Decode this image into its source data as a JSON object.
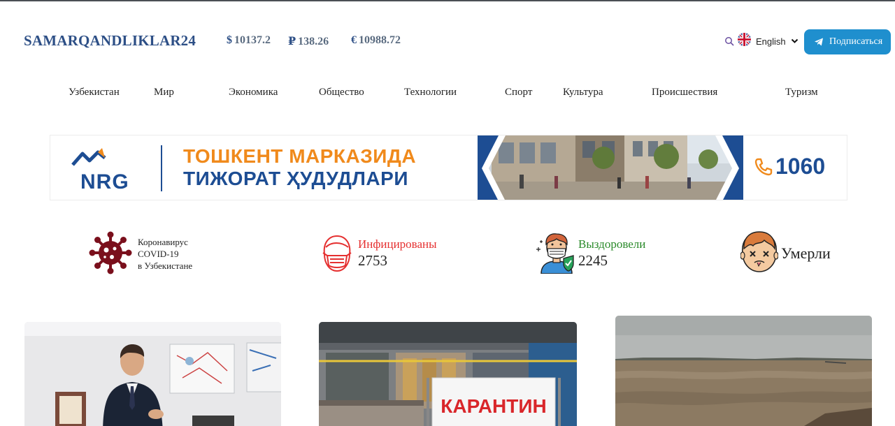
{
  "header": {
    "logo": "SAMARQANDLIKLAR24",
    "rates": [
      {
        "symbol": "$",
        "value": "10137.2"
      },
      {
        "symbol": "₽",
        "value": "138.26"
      },
      {
        "symbol": "€",
        "value": "10988.72"
      }
    ],
    "language": "English",
    "subscribe_label": "Подписаться"
  },
  "nav": {
    "items": [
      "Узбекистан",
      "Мир",
      "Экономика",
      "Общество",
      "Технологии",
      "Спорт",
      "Культура",
      "Происшествия",
      "Туризм"
    ]
  },
  "banner": {
    "brand": "NRG",
    "line1": "ТОШКЕНТ МАРКАЗИДА",
    "line2": "ТИЖОРАТ ҲУДУДЛАРИ",
    "phone": "1060"
  },
  "covid": {
    "title_line1": "Коронавирус",
    "title_line2": "COVID-19",
    "title_line3": "в Узбекистане",
    "infected_label": "Инфицированы",
    "infected_value": "2753",
    "recovered_label": "Выздоровели",
    "recovered_value": "2245",
    "dead_label": "Умерли"
  },
  "cards": [
    {
      "image": "president-speech-photo"
    },
    {
      "image": "quarantine-sign-photo",
      "sign_text": "КАРАНТИН"
    },
    {
      "image": "flood-river-photo"
    }
  ],
  "colors": {
    "brand_blue": "#2d4f86",
    "subscribe_bg": "#1f8fce",
    "infected": "#e53030",
    "recovered": "#2a8a2a",
    "banner_orange": "#f08a1c",
    "banner_blue": "#1d4d93"
  }
}
